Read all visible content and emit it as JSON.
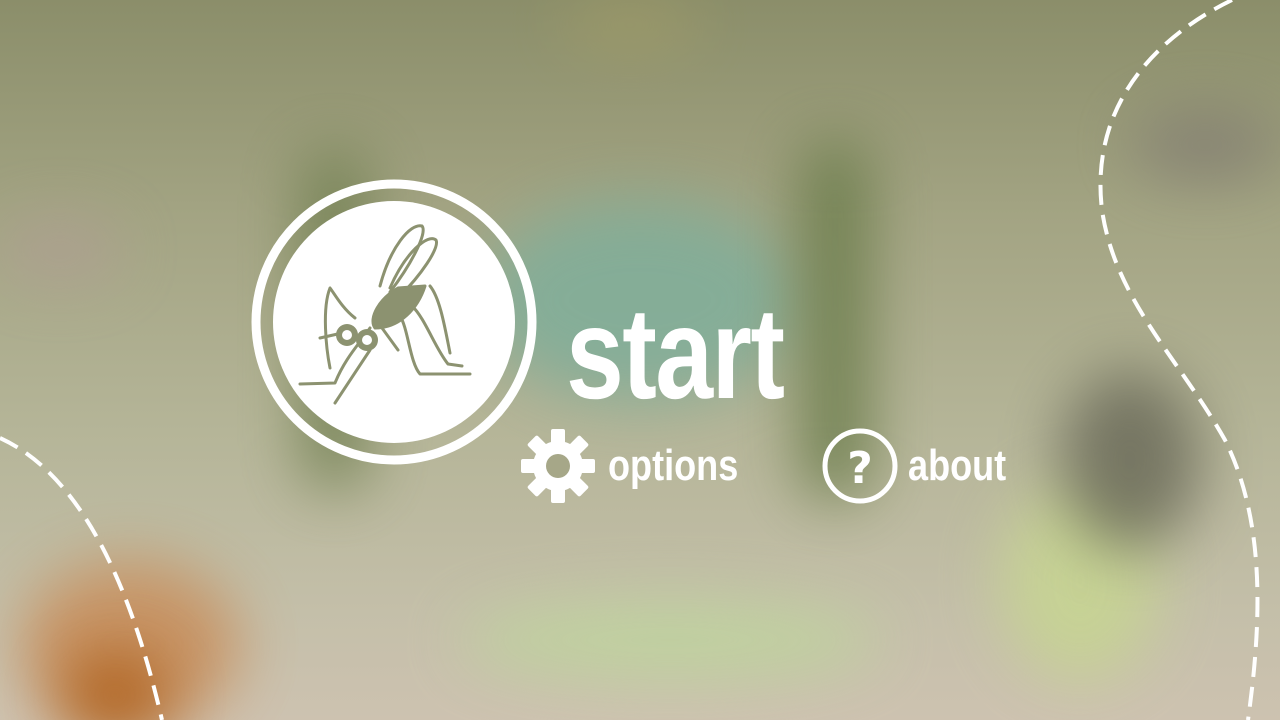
{
  "menu": {
    "start_label": "start",
    "options_label": "options",
    "about_label": "about"
  },
  "icons": {
    "logo": "mosquito-icon",
    "options": "gear-icon",
    "about": "question-icon"
  },
  "colors": {
    "foreground": "#ffffff",
    "logo_ring": "#8c9270"
  }
}
